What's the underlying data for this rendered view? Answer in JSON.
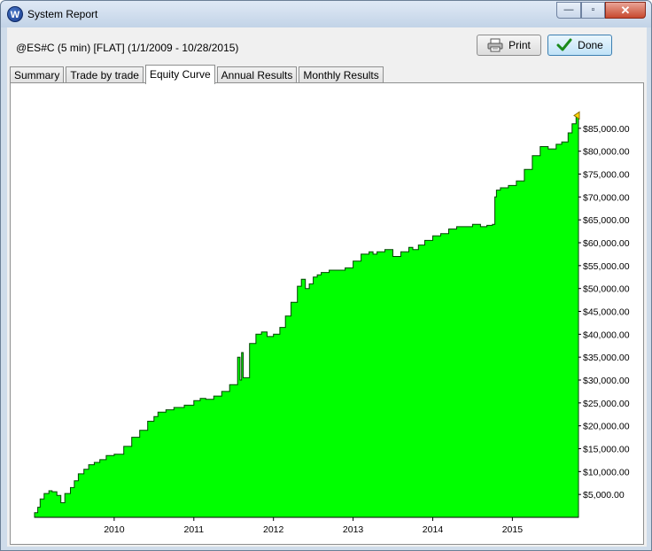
{
  "window": {
    "title": "System Report",
    "icon_letter": "W",
    "controls": {
      "minimize_glyph": "—",
      "maximize_glyph": "▫",
      "close_glyph": "✕"
    }
  },
  "header": {
    "report_title": "@ES#C (5 min) [FLAT]  (1/1/2009 - 10/28/2015)",
    "print_label": "Print",
    "done_label": "Done"
  },
  "tabs": [
    {
      "label": "Summary",
      "active": false
    },
    {
      "label": "Trade by trade",
      "active": false
    },
    {
      "label": "Equity Curve",
      "active": true
    },
    {
      "label": "Annual Results",
      "active": false
    },
    {
      "label": "Monthly Results",
      "active": false
    }
  ],
  "colors": {
    "area_fill": "#00ff00",
    "area_stroke": "#004400",
    "marker": "#ffd800"
  },
  "chart_data": {
    "type": "area",
    "title": "",
    "xlabel": "",
    "ylabel": "",
    "xlim": [
      2009.0,
      2015.83
    ],
    "ylim": [
      0,
      90000
    ],
    "x_ticks": [
      {
        "value": 2010.0,
        "label": "2010"
      },
      {
        "value": 2011.0,
        "label": "2011"
      },
      {
        "value": 2012.0,
        "label": "2012"
      },
      {
        "value": 2013.0,
        "label": "2013"
      },
      {
        "value": 2014.0,
        "label": "2014"
      },
      {
        "value": 2015.0,
        "label": "2015"
      }
    ],
    "y_ticks": [
      {
        "value": 5000,
        "label": "$5,000.00"
      },
      {
        "value": 10000,
        "label": "$10,000.00"
      },
      {
        "value": 15000,
        "label": "$15,000.00"
      },
      {
        "value": 20000,
        "label": "$20,000.00"
      },
      {
        "value": 25000,
        "label": "$25,000.00"
      },
      {
        "value": 30000,
        "label": "$30,000.00"
      },
      {
        "value": 35000,
        "label": "$35,000.00"
      },
      {
        "value": 40000,
        "label": "$40,000.00"
      },
      {
        "value": 45000,
        "label": "$45,000.00"
      },
      {
        "value": 50000,
        "label": "$50,000.00"
      },
      {
        "value": 55000,
        "label": "$55,000.00"
      },
      {
        "value": 60000,
        "label": "$60,000.00"
      },
      {
        "value": 65000,
        "label": "$65,000.00"
      },
      {
        "value": 70000,
        "label": "$70,000.00"
      },
      {
        "value": 75000,
        "label": "$75,000.00"
      },
      {
        "value": 80000,
        "label": "$80,000.00"
      },
      {
        "value": 85000,
        "label": "$85,000.00"
      }
    ],
    "grid": false,
    "y_axis_side": "right",
    "series": [
      {
        "x": [
          2009.0,
          2009.04,
          2009.07,
          2009.12,
          2009.18,
          2009.22,
          2009.28,
          2009.33,
          2009.38,
          2009.45,
          2009.5,
          2009.55,
          2009.62,
          2009.68,
          2009.75,
          2009.82,
          2009.9,
          2010.0,
          2010.12,
          2010.22,
          2010.32,
          2010.42,
          2010.5,
          2010.55,
          2010.65,
          2010.75,
          2010.88,
          2011.0,
          2011.08,
          2011.15,
          2011.25,
          2011.35,
          2011.45,
          2011.55,
          2011.58,
          2011.6,
          2011.62,
          2011.7,
          2011.78,
          2011.85,
          2011.92,
          2012.0,
          2012.08,
          2012.15,
          2012.22,
          2012.3,
          2012.35,
          2012.4,
          2012.45,
          2012.5,
          2012.55,
          2012.6,
          2012.7,
          2012.8,
          2012.9,
          2013.0,
          2013.1,
          2013.2,
          2013.25,
          2013.3,
          2013.4,
          2013.5,
          2013.6,
          2013.7,
          2013.75,
          2013.82,
          2013.9,
          2014.0,
          2014.1,
          2014.2,
          2014.3,
          2014.4,
          2014.5,
          2014.6,
          2014.68,
          2014.75,
          2014.78,
          2014.8,
          2014.85,
          2014.95,
          2015.05,
          2015.15,
          2015.25,
          2015.35,
          2015.45,
          2015.55,
          2015.62,
          2015.7,
          2015.75,
          2015.8,
          2015.83
        ],
        "y": [
          1000,
          2200,
          4000,
          5200,
          5800,
          5600,
          4800,
          3200,
          5200,
          6500,
          8000,
          9500,
          10500,
          11500,
          12000,
          12600,
          13500,
          13800,
          15500,
          17500,
          19000,
          21000,
          22000,
          23000,
          23500,
          24000,
          24500,
          25500,
          26000,
          25800,
          26500,
          27500,
          29000,
          35000,
          30000,
          36000,
          30500,
          38000,
          40000,
          40500,
          39500,
          40000,
          41500,
          44000,
          47000,
          50500,
          52000,
          50000,
          51000,
          52500,
          53000,
          53500,
          54000,
          54000,
          54500,
          56000,
          57500,
          58000,
          57500,
          58000,
          58500,
          57000,
          58000,
          59000,
          58500,
          59500,
          60500,
          61500,
          62000,
          63000,
          63500,
          63500,
          64000,
          63500,
          63800,
          64000,
          70000,
          71500,
          72000,
          72500,
          73500,
          76000,
          79000,
          81000,
          80500,
          81500,
          82000,
          84000,
          86000,
          87500,
          87800
        ]
      }
    ]
  }
}
